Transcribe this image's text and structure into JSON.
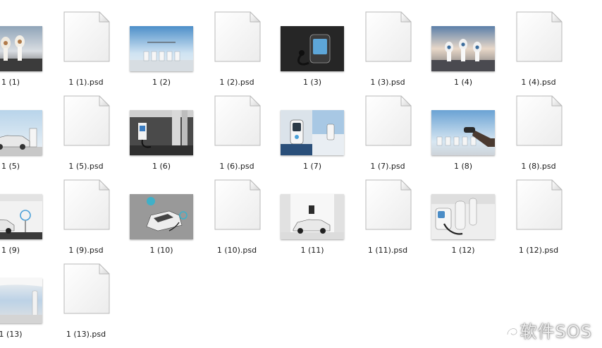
{
  "files": [
    {
      "label": "1 (1)",
      "kind": "image",
      "scene": "towers-sky"
    },
    {
      "label": "1 (1).psd",
      "kind": "document"
    },
    {
      "label": "1 (2)",
      "kind": "image",
      "scene": "row-sky"
    },
    {
      "label": "1 (2).psd",
      "kind": "document"
    },
    {
      "label": "1 (3)",
      "kind": "image",
      "scene": "dark-charger"
    },
    {
      "label": "1 (3).psd",
      "kind": "document"
    },
    {
      "label": "1 (4)",
      "kind": "image",
      "scene": "towers-sunset"
    },
    {
      "label": "1 (4).psd",
      "kind": "document"
    },
    {
      "label": "1 (5)",
      "kind": "image",
      "scene": "car-station"
    },
    {
      "label": "1 (5).psd",
      "kind": "document"
    },
    {
      "label": "1 (6)",
      "kind": "image",
      "scene": "garage"
    },
    {
      "label": "1 (6).psd",
      "kind": "document"
    },
    {
      "label": "1 (7)",
      "kind": "image",
      "scene": "panels"
    },
    {
      "label": "1 (7).psd",
      "kind": "document"
    },
    {
      "label": "1 (8)",
      "kind": "image",
      "scene": "hand-plug"
    },
    {
      "label": "1 (8).psd",
      "kind": "document"
    },
    {
      "label": "1 (9)",
      "kind": "image",
      "scene": "car-wall"
    },
    {
      "label": "1 (9).psd",
      "kind": "document"
    },
    {
      "label": "1 (10)",
      "kind": "image",
      "scene": "car-top"
    },
    {
      "label": "1 (10).psd",
      "kind": "document"
    },
    {
      "label": "1 (11)",
      "kind": "image",
      "scene": "car-hall"
    },
    {
      "label": "1 (11).psd",
      "kind": "document"
    },
    {
      "label": "1 (12)",
      "kind": "image",
      "scene": "plugs-closeup"
    },
    {
      "label": "1 (12).psd",
      "kind": "document"
    },
    {
      "label": "1 (13)",
      "kind": "image",
      "scene": "canopy"
    },
    {
      "label": "1 (13).psd",
      "kind": "document"
    }
  ],
  "watermark": "软件SOS",
  "watermark_icon": "swirl-logo-icon"
}
